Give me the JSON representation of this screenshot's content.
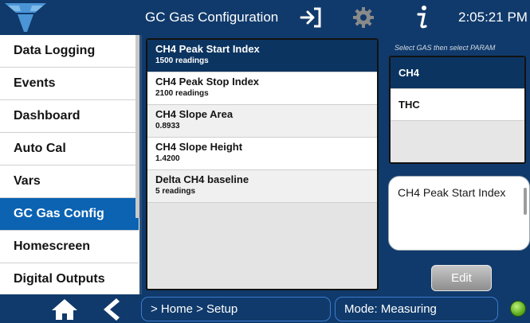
{
  "header": {
    "title": "GC Gas Configuration",
    "time": "2:05:21 PM"
  },
  "sidebar": {
    "items": [
      {
        "label": "Data Logging"
      },
      {
        "label": "Events"
      },
      {
        "label": "Dashboard"
      },
      {
        "label": "Auto Cal"
      },
      {
        "label": "Vars"
      },
      {
        "label": "GC Gas Config"
      },
      {
        "label": "Homescreen"
      },
      {
        "label": "Digital Outputs"
      }
    ],
    "active": "GC Gas Config"
  },
  "params": [
    {
      "name": "CH4 Peak Start Index",
      "value": "1500 readings"
    },
    {
      "name": "CH4 Peak Stop Index",
      "value": "2100 readings"
    },
    {
      "name": "CH4 Slope Area",
      "value": "0.8933"
    },
    {
      "name": "CH4 Slope Height",
      "value": "1.4200"
    },
    {
      "name": "Delta CH4 baseline",
      "value": "5 readings"
    }
  ],
  "selected_param": "CH4 Peak Start Index",
  "gas_panel": {
    "hint": "Select GAS then select PARAM",
    "gases": [
      "CH4",
      "THC"
    ],
    "selected": "CH4"
  },
  "description": "CH4 Peak Start Index",
  "edit_label": "Edit",
  "footer": {
    "breadcrumb": "> Home > Setup",
    "mode": "Mode: Measuring"
  },
  "colors": {
    "bar": "#103a6b",
    "active_nav": "#0b63b2",
    "selected_row": "#0c3461",
    "status_led": "#5fae22"
  },
  "icons": {
    "logo": "teledyne-logo",
    "exit": "exit-icon",
    "settings": "gear-icon",
    "info": "info-icon",
    "home": "home-icon",
    "back": "back-arrow-icon",
    "status": "status-led-icon"
  }
}
